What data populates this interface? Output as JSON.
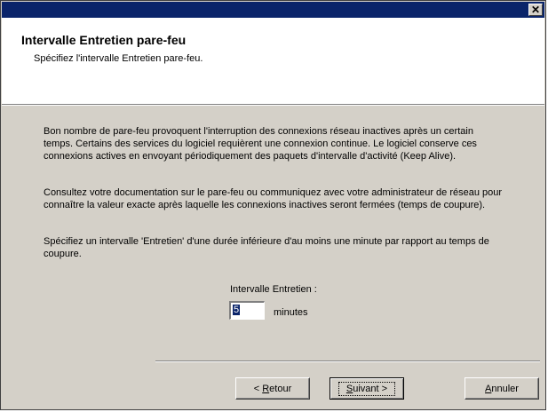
{
  "window": {
    "close_glyph": "✕"
  },
  "header": {
    "title": "Intervalle Entretien pare-feu",
    "subtitle": "Spécifiez l'intervalle Entretien pare-feu."
  },
  "body": {
    "paragraph1": "Bon nombre de pare-feu provoquent l'interruption des connexions réseau inactives après un certain temps. Certains des services du logiciel requièrent une connexion continue. Le logiciel conserve ces connexions actives en envoyant périodiquement des paquets d'intervalle d'activité (Keep Alive).",
    "paragraph2": "Consultez votre documentation sur le pare-feu ou communiquez avec votre administrateur de réseau pour connaître la valeur exacte après laquelle les connexions inactives seront fermées (temps de coupure).",
    "paragraph3": "Spécifiez un intervalle 'Entretien' d'une durée inférieure d'au moins une minute par rapport au temps de coupure."
  },
  "interval": {
    "label": "Intervalle Entretien :",
    "value": "5",
    "units": "minutes"
  },
  "buttons": {
    "back": {
      "prefix": "< ",
      "accel": "R",
      "rest": "etour"
    },
    "next": {
      "accel": "S",
      "rest": "uivant >"
    },
    "cancel": {
      "accel": "A",
      "rest": "nnuler"
    }
  }
}
